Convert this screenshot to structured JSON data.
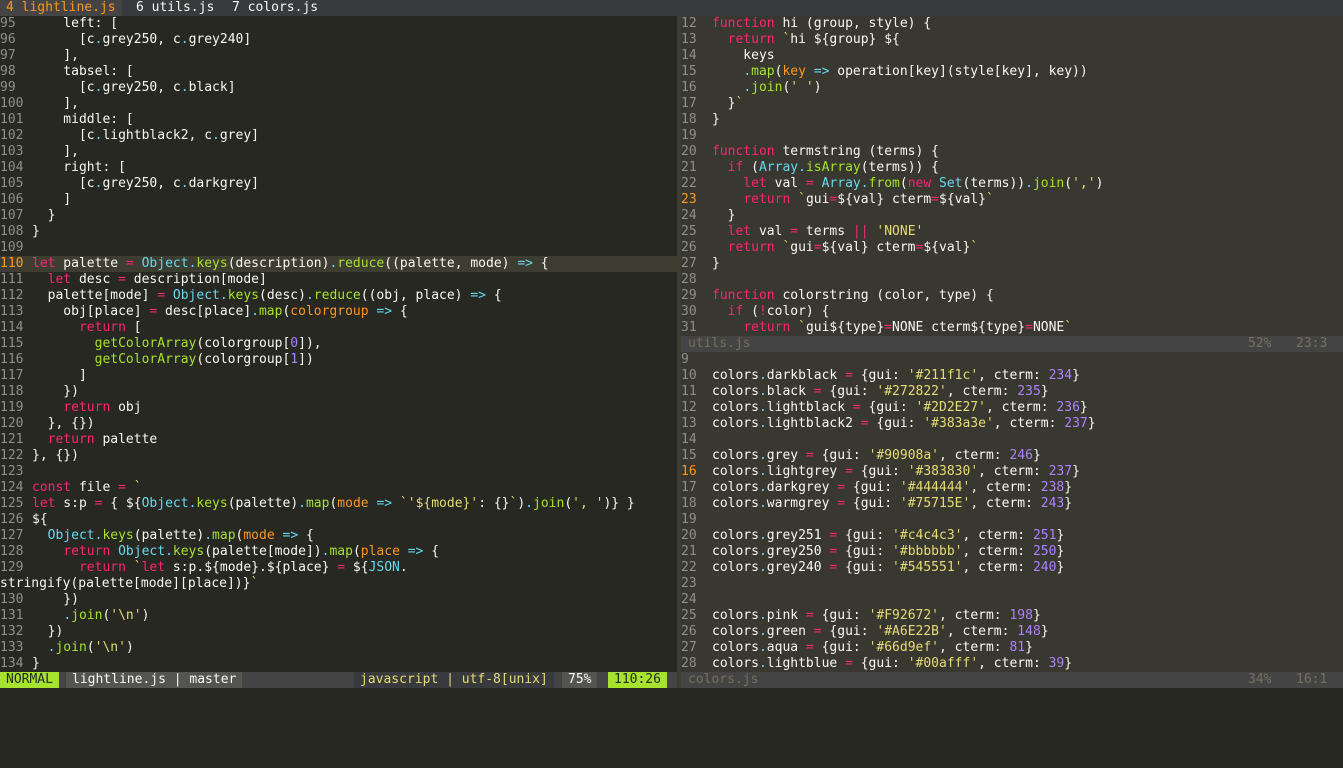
{
  "tabs": [
    {
      "label": "4 lightline.js",
      "active": true
    },
    {
      "label": "6 utils.js",
      "active": false
    },
    {
      "label": "7 colors.js",
      "active": false
    }
  ],
  "left_pane": {
    "lines": [
      {
        "n": "95",
        "t": "    left: ["
      },
      {
        "n": "96",
        "t": "      [c.grey250, c.grey240]"
      },
      {
        "n": "97",
        "t": "    ],"
      },
      {
        "n": "98",
        "t": "    tabsel: ["
      },
      {
        "n": "99",
        "t": "      [c.grey250, c.black]"
      },
      {
        "n": "100",
        "t": "    ],"
      },
      {
        "n": "101",
        "t": "    middle: ["
      },
      {
        "n": "102",
        "t": "      [c.lightblack2, c.grey]"
      },
      {
        "n": "103",
        "t": "    ],"
      },
      {
        "n": "104",
        "t": "    right: ["
      },
      {
        "n": "105",
        "t": "      [c.grey250, c.darkgrey]"
      },
      {
        "n": "106",
        "t": "    ]"
      },
      {
        "n": "107",
        "t": "  }"
      },
      {
        "n": "108",
        "t": "}"
      },
      {
        "n": "109",
        "t": ""
      },
      {
        "n": "110",
        "t": "let palette = Object.keys(description).reduce((palette, mode) => {",
        "cur": true
      },
      {
        "n": "111",
        "t": "  let desc = description[mode]"
      },
      {
        "n": "112",
        "t": "  palette[mode] = Object.keys(desc).reduce((obj, place) => {"
      },
      {
        "n": "113",
        "t": "    obj[place] = desc[place].map(colorgroup => {"
      },
      {
        "n": "114",
        "t": "      return ["
      },
      {
        "n": "115",
        "t": "        getColorArray(colorgroup[0]),"
      },
      {
        "n": "116",
        "t": "        getColorArray(colorgroup[1])"
      },
      {
        "n": "117",
        "t": "      ]"
      },
      {
        "n": "118",
        "t": "    })"
      },
      {
        "n": "119",
        "t": "    return obj"
      },
      {
        "n": "120",
        "t": "  }, {})"
      },
      {
        "n": "121",
        "t": "  return palette"
      },
      {
        "n": "122",
        "t": "}, {})"
      },
      {
        "n": "123",
        "t": ""
      },
      {
        "n": "124",
        "t": "const file = `"
      },
      {
        "n": "125",
        "t": "let s:p = { ${Object.keys(palette).map(mode => `'${mode}': {}`).join(', ')} }"
      },
      {
        "n": "126",
        "t": "${"
      },
      {
        "n": "127",
        "t": "  Object.keys(palette).map(mode => {"
      },
      {
        "n": "128",
        "t": "    return Object.keys(palette[mode]).map(place => {"
      },
      {
        "n": "129",
        "t": "      return `let s:p.${mode}.${place} = ${JSON."
      },
      {
        "n": "",
        "t": "stringify(palette[mode][place])}`"
      },
      {
        "n": "130",
        "t": "    })"
      },
      {
        "n": "131",
        "t": "    .join('\\n')"
      },
      {
        "n": "132",
        "t": "  })"
      },
      {
        "n": "133",
        "t": "  .join('\\n')"
      },
      {
        "n": "134",
        "t": "}"
      }
    ]
  },
  "right_top_pane": {
    "lines": [
      {
        "n": "12",
        "t": "function hi (group, style) {"
      },
      {
        "n": "13",
        "t": "  return `hi ${group} ${"
      },
      {
        "n": "14",
        "t": "    keys"
      },
      {
        "n": "15",
        "t": "    .map(key => operation[key](style[key], key))"
      },
      {
        "n": "16",
        "t": "    .join(' ')"
      },
      {
        "n": "17",
        "t": "  }`"
      },
      {
        "n": "18",
        "t": "}"
      },
      {
        "n": "19",
        "t": ""
      },
      {
        "n": "20",
        "t": "function termstring (terms) {"
      },
      {
        "n": "21",
        "t": "  if (Array.isArray(terms)) {"
      },
      {
        "n": "22",
        "t": "    let val = Array.from(new Set(terms)).join(',')"
      },
      {
        "n": "23",
        "t": "    return `gui=${val} cterm=${val}`",
        "cur": true
      },
      {
        "n": "24",
        "t": "  }"
      },
      {
        "n": "25",
        "t": "  let val = terms || 'NONE'"
      },
      {
        "n": "26",
        "t": "  return `gui=${val} cterm=${val}`"
      },
      {
        "n": "27",
        "t": "}"
      },
      {
        "n": "28",
        "t": ""
      },
      {
        "n": "29",
        "t": "function colorstring (color, type) {"
      },
      {
        "n": "30",
        "t": "  if (!color) {"
      },
      {
        "n": "31",
        "t": "    return `gui${type}=NONE cterm${type}=NONE`"
      }
    ],
    "status": {
      "file": "utils.js",
      "percent": "52%",
      "position": "23:3"
    }
  },
  "right_bottom_pane": {
    "lines": [
      {
        "n": "9",
        "t": ""
      },
      {
        "n": "10",
        "t": "colors.darkblack = {gui: '#211f1c', cterm: 234}"
      },
      {
        "n": "11",
        "t": "colors.black = {gui: '#272822', cterm: 235}"
      },
      {
        "n": "12",
        "t": "colors.lightblack = {gui: '#2D2E27', cterm: 236}"
      },
      {
        "n": "13",
        "t": "colors.lightblack2 = {gui: '#383a3e', cterm: 237}"
      },
      {
        "n": "14",
        "t": ""
      },
      {
        "n": "15",
        "t": "colors.grey = {gui: '#90908a', cterm: 246}"
      },
      {
        "n": "16",
        "t": "colors.lightgrey = {gui: '#383830', cterm: 237}",
        "cur": true
      },
      {
        "n": "17",
        "t": "colors.darkgrey = {gui: '#444444', cterm: 238}"
      },
      {
        "n": "18",
        "t": "colors.warmgrey = {gui: '#75715E', cterm: 243}"
      },
      {
        "n": "19",
        "t": ""
      },
      {
        "n": "20",
        "t": "colors.grey251 = {gui: '#c4c4c3', cterm: 251}"
      },
      {
        "n": "21",
        "t": "colors.grey250 = {gui: '#bbbbbb', cterm: 250}"
      },
      {
        "n": "22",
        "t": "colors.grey240 = {gui: '#545551', cterm: 240}"
      },
      {
        "n": "23",
        "t": ""
      },
      {
        "n": "24",
        "t": ""
      },
      {
        "n": "25",
        "t": "colors.pink = {gui: '#F92672', cterm: 198}"
      },
      {
        "n": "26",
        "t": "colors.green = {gui: '#A6E22B', cterm: 148}"
      },
      {
        "n": "27",
        "t": "colors.aqua = {gui: '#66d9ef', cterm: 81}"
      },
      {
        "n": "28",
        "t": "colors.lightblue = {gui: '#00afff', cterm: 39}"
      }
    ],
    "status": {
      "file": "colors.js",
      "percent": "34%",
      "position": "16:1"
    }
  },
  "statusline": {
    "mode": "NORMAL",
    "file_branch": "lightline.js | master",
    "filetype_encoding": "javascript | utf-8[unix]",
    "percent": "75%",
    "position": "110:26"
  },
  "colors": {
    "background": "#272822",
    "inactive_pane": "#383830",
    "accent_orange": "#fd971f",
    "mode_green": "#a6e22e",
    "keyword_pink": "#f92672",
    "type_aqua": "#66d9ef",
    "string_yellow": "#e6db74",
    "number_purple": "#ae81ff"
  }
}
